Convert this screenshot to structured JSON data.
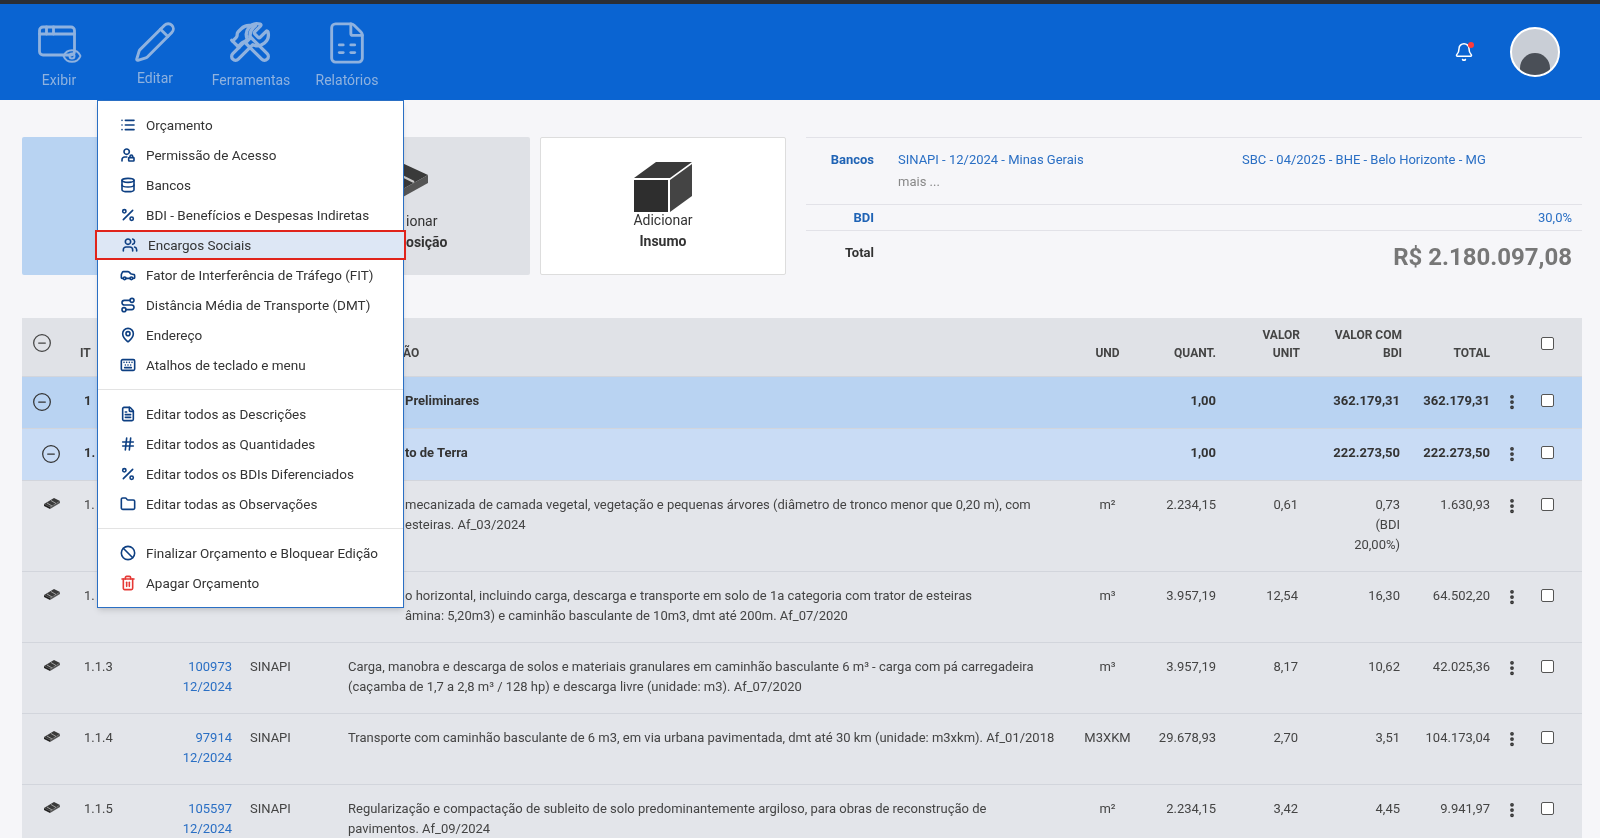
{
  "toolbar": [
    {
      "label": "Exibir",
      "kind": "view"
    },
    {
      "label": "Editar",
      "kind": "edit"
    },
    {
      "label": "Ferramentas",
      "kind": "tools"
    },
    {
      "label": "Relatórios",
      "kind": "reports"
    }
  ],
  "menu": {
    "groups": [
      [
        {
          "label": "Orçamento",
          "kind": "list",
          "selected": false
        },
        {
          "label": "Permissão de Acesso",
          "kind": "user-lock",
          "selected": false
        },
        {
          "label": "Bancos",
          "kind": "database",
          "selected": false
        },
        {
          "label": "BDI - Benefícios e Despesas Indiretas",
          "kind": "percent",
          "selected": false
        },
        {
          "label": "Encargos Sociais",
          "kind": "users",
          "selected": true
        },
        {
          "label": "Fator de Interferência de Tráfego (FIT)",
          "kind": "car",
          "selected": false
        },
        {
          "label": "Distância Média de Transporte (DMT)",
          "kind": "route",
          "selected": false
        },
        {
          "label": "Endereço",
          "kind": "pin",
          "selected": false
        },
        {
          "label": "Atalhos de teclado e menu",
          "kind": "keyboard",
          "selected": false
        }
      ],
      [
        {
          "label": "Editar todos as Descrições",
          "kind": "file",
          "selected": false
        },
        {
          "label": "Editar todos as Quantidades",
          "kind": "hash",
          "selected": false
        },
        {
          "label": "Editar todos os BDIs Diferenciados",
          "kind": "percent",
          "selected": false
        },
        {
          "label": "Editar todas as Observações",
          "kind": "folder",
          "selected": false
        }
      ],
      [
        {
          "label": "Finalizar Orçamento e Bloquear Edição",
          "kind": "ban",
          "selected": false
        },
        {
          "label": "Apagar Orçamento",
          "kind": "trash",
          "selected": false
        }
      ]
    ]
  },
  "cards": [
    {
      "kind": "composition",
      "title": "ionar",
      "subtitle": "osição"
    },
    {
      "kind": "input",
      "title": "Adicionar",
      "subtitle": "Insumo"
    }
  ],
  "summary": {
    "banks_label": "Bancos",
    "banks": [
      "SINAPI - 12/2024 - Minas Gerais",
      "SBC - 04/2025 - BHE - Belo Horizonte - MG"
    ],
    "more": "mais ...",
    "bdi_label": "BDI",
    "bdi": "30,0%",
    "total_label": "Total",
    "total": "R$ 2.180.097,08"
  },
  "table": {
    "columns": [
      "IT",
      "ÃO",
      "UND",
      "QUANT.",
      "VALOR UNIT",
      "VALOR COM BDI",
      "TOTAL"
    ],
    "all_checked": false,
    "rows": [
      {
        "kind": "group",
        "covered": true,
        "item": "1",
        "description": "Preliminares",
        "quantity": "1,00",
        "bdi_value": "362.179,31",
        "total": "362.179,31",
        "checked": false
      },
      {
        "kind": "subgroup",
        "covered": true,
        "item": "1.",
        "description": "to de Terra",
        "quantity": "1,00",
        "bdi_value": "222.273,50",
        "total": "222.273,50",
        "checked": false
      },
      {
        "kind": "item",
        "covered": true,
        "item": "1.",
        "description": "mecanizada de camada vegetal, vegetação e pequenas árvores (diâmetro de tronco menor que 0,20 m), com",
        "description_2": "esteiras. Af_03/2024",
        "unit": "m²",
        "quantity": "2.234,15",
        "unit_value": "0,61",
        "bdi_value": "0,73",
        "bdi_note": "(BDI 20,00%)",
        "total": "1.630,93",
        "checked": false
      },
      {
        "kind": "item",
        "covered": true,
        "item": "1.",
        "description": "o horizontal, incluindo carga, descarga e transporte em solo de 1a categoria com trator de esteiras",
        "description_2": "âmina: 5,20m3) e caminhão basculante de 10m3, dmt até 200m. Af_07/2020",
        "unit": "m³",
        "quantity": "3.957,19",
        "unit_value": "12,54",
        "bdi_value": "16,30",
        "total": "64.502,20",
        "checked": false
      },
      {
        "kind": "item",
        "covered": false,
        "item": "1.1.3",
        "code": "100973",
        "date": "12/2024",
        "source": "SINAPI",
        "description": "Carga, manobra e descarga de solos e materiais granulares em caminhão basculante 6 m³ - carga com pá carregadeira (caçamba de 1,7 a 2,8 m³ / 128 hp) e descarga livre (unidade: m3). Af_07/2020",
        "unit": "m³",
        "quantity": "3.957,19",
        "unit_value": "8,17",
        "bdi_value": "10,62",
        "total": "42.025,36",
        "checked": false
      },
      {
        "kind": "item",
        "covered": false,
        "item": "1.1.4",
        "code": "97914",
        "date": "12/2024",
        "source": "SINAPI",
        "description": "Transporte com caminhão basculante de 6 m3, em via urbana pavimentada, dmt até 30 km (unidade: m3xkm). Af_01/2018",
        "unit": "M3XKM",
        "quantity": "29.678,93",
        "unit_value": "2,70",
        "bdi_value": "3,51",
        "total": "104.173,04",
        "checked": false
      },
      {
        "kind": "item",
        "covered": false,
        "item": "1.1.5",
        "code": "105597",
        "date": "12/2024",
        "source": "SINAPI",
        "description": "Regularização e compactação de subleito de solo predominantemente argiloso, para obras de reconstrução de pavimentos. Af_09/2024",
        "unit": "m²",
        "quantity": "2.234,15",
        "unit_value": "3,42",
        "bdi_value": "4,45",
        "total": "9.941,97",
        "checked": false
      }
    ]
  }
}
